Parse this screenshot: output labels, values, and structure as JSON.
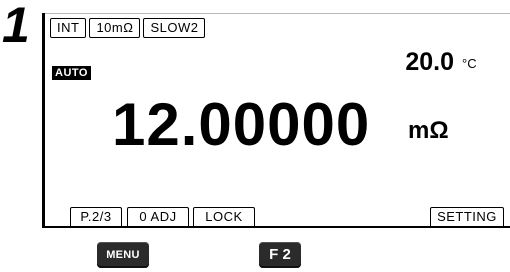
{
  "step": {
    "number": "1"
  },
  "status_tags": [
    {
      "label": "INT"
    },
    {
      "label": "10mΩ"
    },
    {
      "label": "SLOW2"
    }
  ],
  "range_mode": {
    "label": "AUTO"
  },
  "temperature": {
    "value": "20.0",
    "unit": "°C"
  },
  "measurement": {
    "value": "12.00000",
    "unit": "mΩ"
  },
  "softkeys": [
    {
      "label": "P.2/3"
    },
    {
      "label": "0 ADJ"
    },
    {
      "label": "LOCK"
    },
    {
      "label": "SETTING"
    }
  ],
  "hardware_keys": {
    "menu": {
      "label": "MENU"
    },
    "f2": {
      "label": "F 2"
    }
  },
  "colors": {
    "screen_background": "#ffffff",
    "foreground": "#000000",
    "key_background": "#2b2b2b",
    "key_text": "#ffffff"
  }
}
